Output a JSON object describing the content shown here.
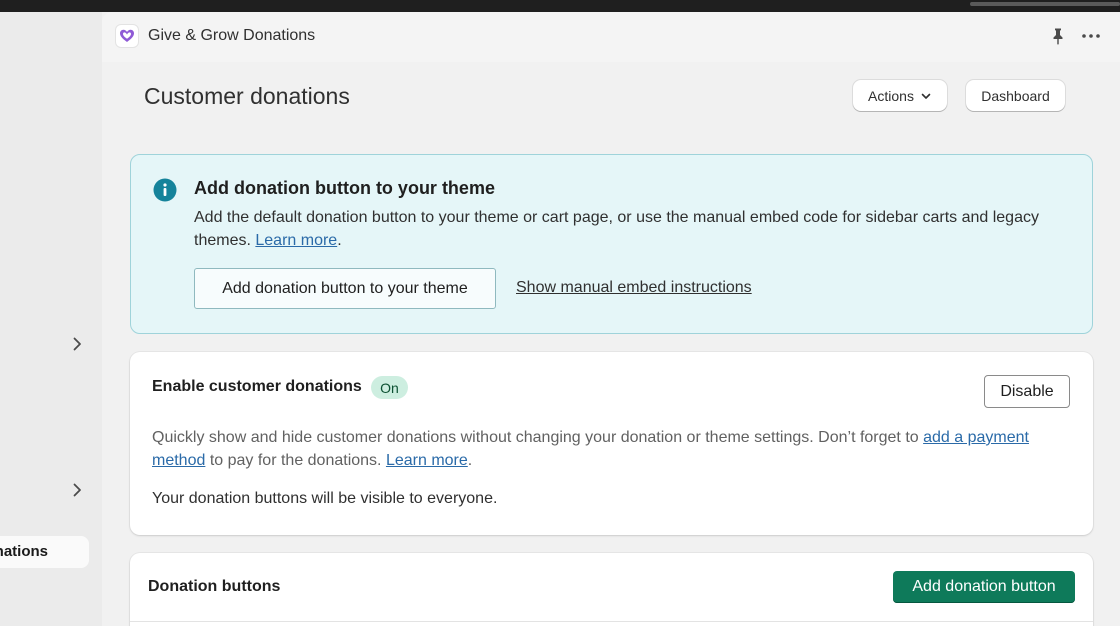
{
  "nav": {
    "active_item_label": "Donations"
  },
  "app_header": {
    "title": "Give & Grow Donations",
    "logo_icon": "heart-icon",
    "pin_icon": "pin-icon",
    "more_icon": "more-horizontal-icon"
  },
  "page": {
    "title": "Customer donations",
    "actions_label": "Actions",
    "dashboard_label": "Dashboard"
  },
  "banner": {
    "title": "Add donation button to your theme",
    "body_text": "Add the default donation button to your theme or cart page, or use the manual embed code for sidebar carts and legacy themes.",
    "learn_more": "Learn more",
    "primary_button": "Add donation button to your theme",
    "secondary_link": "Show manual embed instructions"
  },
  "enable_card": {
    "title": "Enable customer donations",
    "status_badge": "On",
    "disable_button": "Disable",
    "description_part1": "Quickly show and hide customer donations without changing your donation or theme settings. Don’t forget to ",
    "payment_link": "add a payment method",
    "description_part2": " to pay for the donations.",
    "learn_more": "Learn more",
    "visibility_note": "Your donation buttons will be visible to everyone."
  },
  "buttons_card": {
    "title": "Donation buttons",
    "add_button": "Add donation button"
  },
  "colors": {
    "accent_green": "#0e7a5a",
    "info_bg": "#e5f6f8",
    "info_icon": "#15839b",
    "link": "#2a6aa8",
    "badge_bg": "#cdeee0"
  }
}
